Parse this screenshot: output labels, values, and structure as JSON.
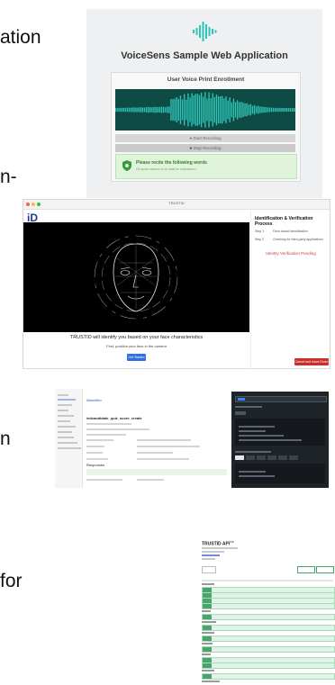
{
  "slide_fragments": {
    "top": "ation",
    "second": "n-",
    "third": "n",
    "fourth": "for"
  },
  "voicesens": {
    "title": "VoiceSens Sample Web Application",
    "panel_title": "User Voice Print Enrollment",
    "start_recording": "Start Recording",
    "stop_recording": "Stop Recording",
    "notice_title": "Please recite the following words",
    "notice_sub": "Ok audio session is ok shall be submission",
    "accent_color": "#2ec4b6",
    "icons": [
      "soundwave-logo-icon",
      "shield-icon"
    ]
  },
  "trustid_app": {
    "window_title": "TRUSTID",
    "logo": "iD",
    "caption_main": "TRUSTID will identify you based on your face characteristics",
    "caption_sub": "First, position your face in the camera",
    "get_started": "Get Started",
    "side_title": "Identification & Verification Process",
    "steps": [
      {
        "label": "Step 1",
        "text": "Face-based identification"
      },
      {
        "label": "Step 2",
        "text": "Checking for third-party applications"
      }
    ],
    "status": "Identity Verification Pending",
    "cancel": "Cancel and leave Exam",
    "button_color": "#2f6fdf",
    "danger_color": "#c9302c"
  },
  "api_docs": {
    "heading": "ilidentifier",
    "endpoint": "/mlcandidate_quiz_score_create",
    "response_label": "Responses"
  },
  "trustid_api": {
    "title": "TRUSTID API",
    "version_badge": "1.0"
  }
}
